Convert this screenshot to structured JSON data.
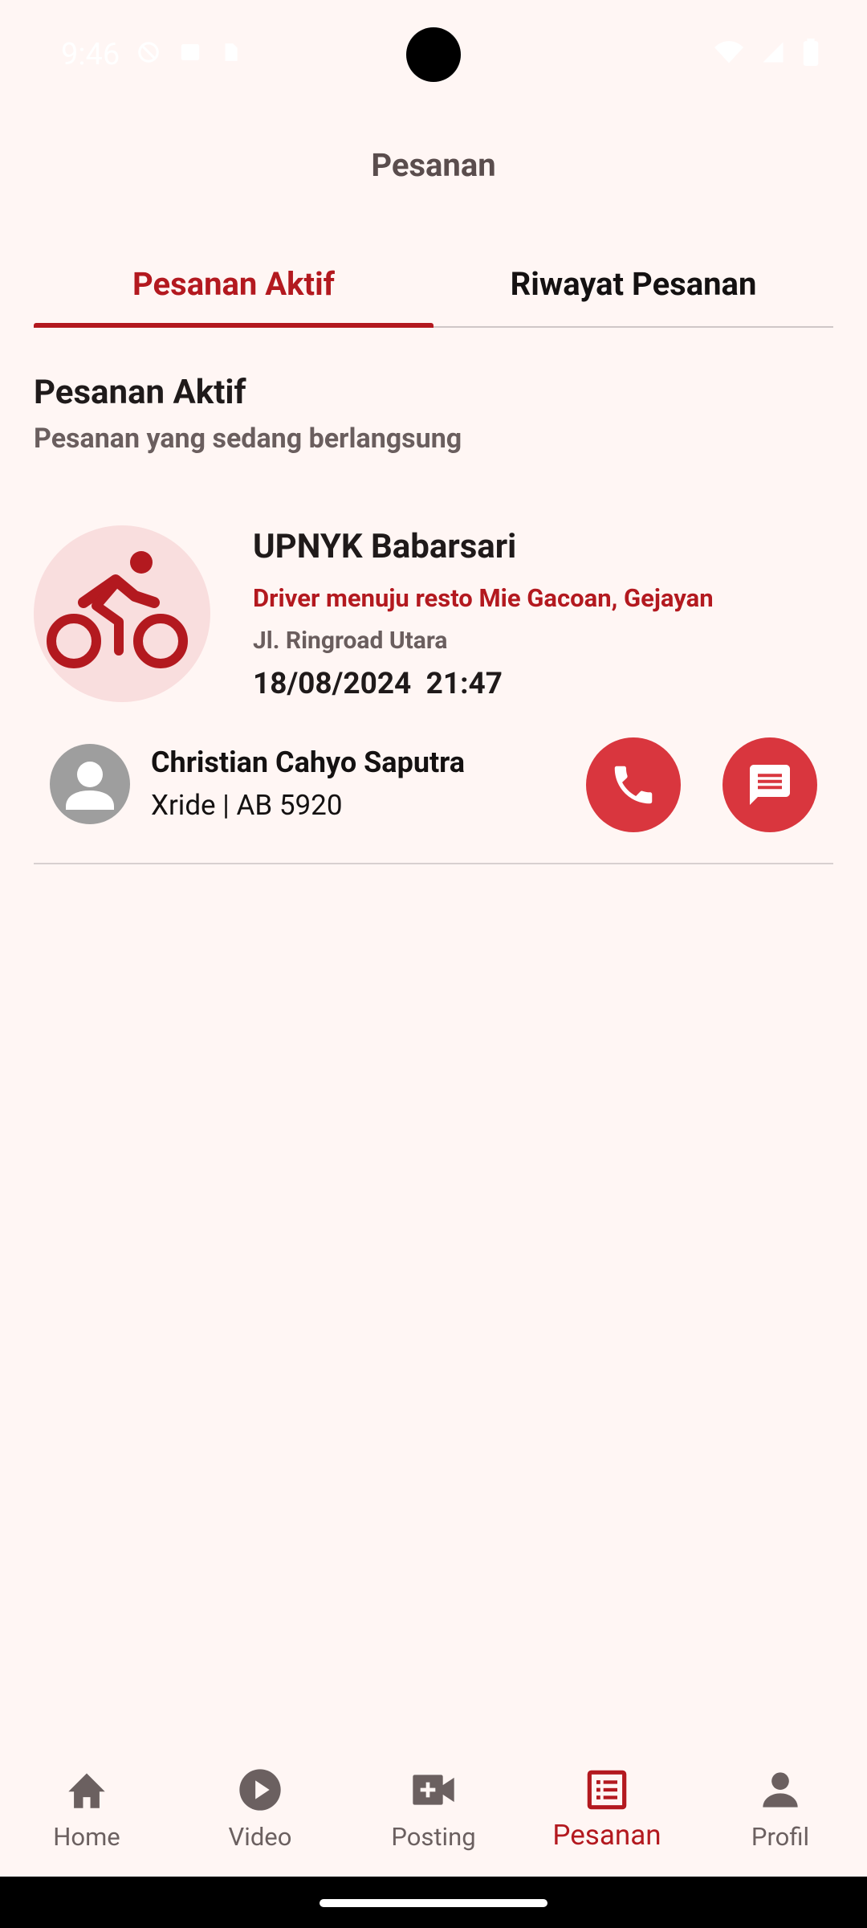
{
  "status_bar": {
    "time": "9:46",
    "icons_left": [
      "dnd-icon",
      "photo-icon",
      "sd-card-icon"
    ],
    "icons_right": [
      "wifi-icon",
      "signal-icon",
      "battery-icon"
    ]
  },
  "appbar": {
    "title": "Pesanan"
  },
  "tabs": [
    {
      "label": "Pesanan Aktif",
      "active": true
    },
    {
      "label": "Riwayat Pesanan",
      "active": false
    }
  ],
  "section": {
    "title": "Pesanan Aktif",
    "subtitle": "Pesanan yang sedang berlangsung"
  },
  "order": {
    "icon": "bicycle-icon",
    "title": "UPNYK Babarsari",
    "status": "Driver menuju resto Mie Gacoan, Gejayan",
    "address": "Jl. Ringroad Utara",
    "datetime": "18/08/2024  21:47"
  },
  "driver": {
    "name": "Christian Cahyo Saputra",
    "vehicle": "Xride | AB 5920"
  },
  "nav": [
    {
      "label": "Home",
      "icon": "home-icon",
      "active": false
    },
    {
      "label": "Video",
      "icon": "play-icon",
      "active": false
    },
    {
      "label": "Posting",
      "icon": "video-add-icon",
      "active": false
    },
    {
      "label": "Pesanan",
      "icon": "list-icon",
      "active": true
    },
    {
      "label": "Profil",
      "icon": "person-icon",
      "active": false
    }
  ],
  "colors": {
    "accent": "#b3191f",
    "button": "#d9363e",
    "background": "#fff6f4",
    "icon_circle": "#f9dede"
  }
}
